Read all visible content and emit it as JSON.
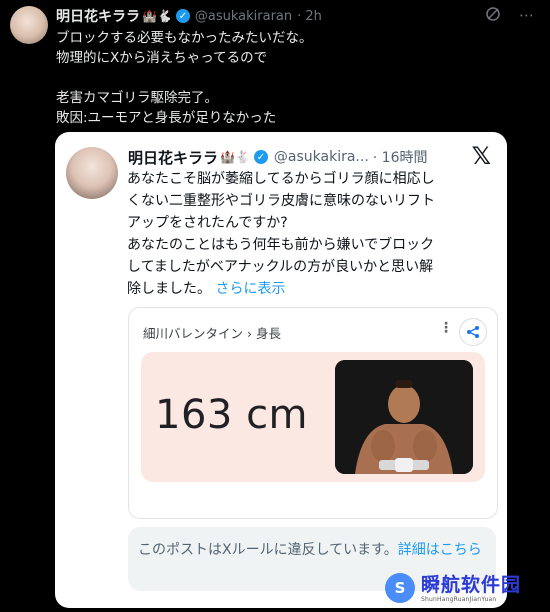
{
  "post": {
    "author_name": "明日花キララ",
    "author_emoji": "🏰🐇",
    "handle": "@asukakiraran",
    "time": "· 2h",
    "lines": [
      "ブロックする必要もなかったみたいだな。",
      "物理的にXから消えちゃってるので",
      "",
      "老害カマゴリラ駆除完了。",
      "敗因:ユーモアと身長が足りなかった"
    ],
    "icons": [
      "grok-icon",
      "more-icon"
    ]
  },
  "quote": {
    "author_name": "明日花キララ",
    "author_emoji": "🏰🐇",
    "handle": "@asukakira...",
    "time": "· 16時間",
    "lines": [
      "あなたこそ脳が萎縮してるからゴリラ顔に相応し",
      "くない二重整形やゴリラ皮膚に意味のないリフト",
      "アップをされたんですか?",
      "あなたのことはもう何年も前から嫌いでブロック",
      "してましたがベアナックルの方が良いかと思い解"
    ],
    "last_line": "除しました。",
    "show_more": "さらに表示",
    "card": {
      "title": "細川バレンタイン › 身長",
      "value": "163 cm"
    },
    "notice": {
      "text": "このポストはXルールに違反しています。",
      "link": "詳細はこちら"
    }
  },
  "watermark": {
    "title": "瞬航软件园",
    "subtitle": "ShunHangRuanJianYuan"
  },
  "colors": {
    "accent": "#1d9bf0",
    "background": "#000000",
    "card_result": "#fbe8e2"
  }
}
